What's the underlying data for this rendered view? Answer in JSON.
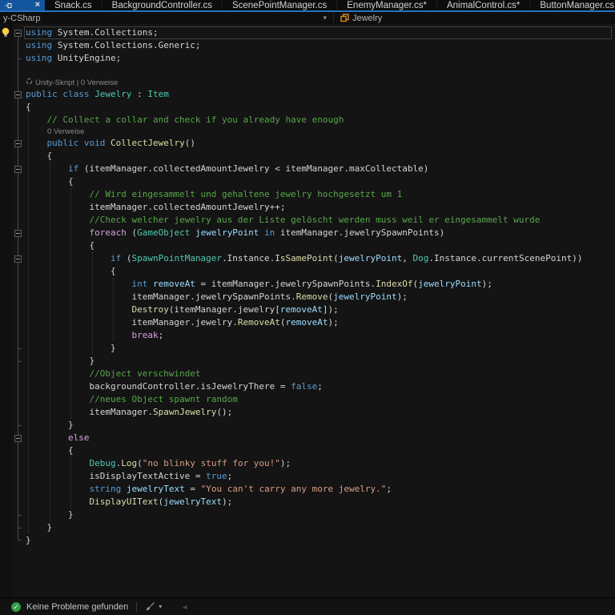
{
  "colors": {
    "accent_tab_blue": "#14569d",
    "accent_underline": "#2572c4",
    "keyword": "#569cd6",
    "control": "#d8a0df",
    "type": "#4ec9b0",
    "method": "#dcdcaa",
    "variable": "#9cdcfe",
    "string": "#d69d85",
    "comment": "#57a64a",
    "plain": "#d4d4d4",
    "status_green": "#2f9e44"
  },
  "tab_bar": {
    "active_tab": {
      "pinned": true,
      "close_label": "×"
    },
    "tabs": [
      "Snack.cs",
      "BackgroundController.cs",
      "ScenePointManager.cs",
      "EnemyManager.cs*",
      "AnimalControl.cs*",
      "ButtonManager.cs"
    ]
  },
  "nav_bar": {
    "project": "y-CSharp",
    "project_caret": "▾",
    "member": "Jewelry"
  },
  "status_bar": {
    "health": "Keine Probleme gefunden",
    "cleanup_caret": "▾",
    "scroll_left_arrow": "◄"
  },
  "code": {
    "lines": [
      {
        "t": "code",
        "fold": true,
        "current": true,
        "bulb": true,
        "tokens": [
          [
            "k",
            "using"
          ],
          [
            "p",
            " System.Collections;"
          ]
        ]
      },
      {
        "t": "code",
        "tokens": [
          [
            "k",
            "using"
          ],
          [
            "p",
            " System.Collections.Generic;"
          ]
        ]
      },
      {
        "t": "code",
        "tokens": [
          [
            "k",
            "using"
          ],
          [
            "p",
            " UnityEngine;"
          ]
        ]
      },
      {
        "t": "blank",
        "tokens": []
      },
      {
        "t": "lens",
        "indent": 3,
        "icon": true,
        "text": "Unity-Skript | 0 Verweise"
      },
      {
        "t": "code",
        "fold": true,
        "tokens": [
          [
            "k",
            "public"
          ],
          [
            "p",
            " "
          ],
          [
            "k",
            "class"
          ],
          [
            "p",
            " "
          ],
          [
            "t",
            "Jewelry"
          ],
          [
            "p",
            " : "
          ],
          [
            "t",
            "Item"
          ]
        ]
      },
      {
        "t": "code",
        "tokens": [
          [
            "p",
            "{"
          ]
        ]
      },
      {
        "t": "code",
        "tokens": [
          [
            "cm",
            "    // Collect a collar and check if you already have enough"
          ]
        ]
      },
      {
        "t": "lens",
        "indent": 30,
        "icon": false,
        "text": "0 Verweise"
      },
      {
        "t": "code",
        "fold": true,
        "tokens": [
          [
            "p",
            "    "
          ],
          [
            "k",
            "public"
          ],
          [
            "p",
            " "
          ],
          [
            "k",
            "void"
          ],
          [
            "p",
            " "
          ],
          [
            "m",
            "CollectJewelry"
          ],
          [
            "p",
            "()"
          ]
        ]
      },
      {
        "t": "code",
        "tokens": [
          [
            "p",
            "    {"
          ]
        ]
      },
      {
        "t": "code",
        "fold": true,
        "tokens": [
          [
            "p",
            "        "
          ],
          [
            "k",
            "if"
          ],
          [
            "p",
            " (itemManager.collectedAmountJewelry < itemManager.maxCollectable)"
          ]
        ]
      },
      {
        "t": "code",
        "tokens": [
          [
            "p",
            "        {"
          ]
        ]
      },
      {
        "t": "code",
        "tokens": [
          [
            "cm",
            "            // Wird eingesammelt und gehaltene jewelry hochgesetzt um 1"
          ]
        ]
      },
      {
        "t": "code",
        "tokens": [
          [
            "p",
            "            itemManager.collectedAmountJewelry++;"
          ]
        ]
      },
      {
        "t": "code",
        "tokens": [
          [
            "cm",
            "            //Check welcher jewelry aus der Liste gelöscht werden muss weil er eingesammelt wurde"
          ]
        ]
      },
      {
        "t": "code",
        "fold": true,
        "tokens": [
          [
            "p",
            "            "
          ],
          [
            "c",
            "foreach"
          ],
          [
            "p",
            " ("
          ],
          [
            "t",
            "GameObject"
          ],
          [
            "p",
            " "
          ],
          [
            "v",
            "jewelryPoint"
          ],
          [
            "p",
            " "
          ],
          [
            "k",
            "in"
          ],
          [
            "p",
            " itemManager.jewelrySpawnPoints)"
          ]
        ]
      },
      {
        "t": "code",
        "tokens": [
          [
            "p",
            "            {"
          ]
        ]
      },
      {
        "t": "code",
        "fold": true,
        "tokens": [
          [
            "p",
            "                "
          ],
          [
            "k",
            "if"
          ],
          [
            "p",
            " ("
          ],
          [
            "t",
            "SpawnPointManager"
          ],
          [
            "p",
            ".Instance."
          ],
          [
            "m",
            "IsSamePoint"
          ],
          [
            "p",
            "("
          ],
          [
            "v",
            "jewelryPoint"
          ],
          [
            "p",
            ", "
          ],
          [
            "t",
            "Dog"
          ],
          [
            "p",
            ".Instance.currentScenePoint))"
          ]
        ]
      },
      {
        "t": "code",
        "tokens": [
          [
            "p",
            "                {"
          ]
        ]
      },
      {
        "t": "code",
        "tokens": [
          [
            "p",
            "                    "
          ],
          [
            "k",
            "int"
          ],
          [
            "p",
            " "
          ],
          [
            "v",
            "removeAt"
          ],
          [
            "p",
            " = itemManager.jewelrySpawnPoints."
          ],
          [
            "m",
            "IndexOf"
          ],
          [
            "p",
            "("
          ],
          [
            "v",
            "jewelryPoint"
          ],
          [
            "p",
            ");"
          ]
        ]
      },
      {
        "t": "code",
        "tokens": [
          [
            "p",
            "                    itemManager.jewelrySpawnPoints."
          ],
          [
            "m",
            "Remove"
          ],
          [
            "p",
            "("
          ],
          [
            "v",
            "jewelryPoint"
          ],
          [
            "p",
            ");"
          ]
        ]
      },
      {
        "t": "code",
        "tokens": [
          [
            "p",
            "                    "
          ],
          [
            "m",
            "Destroy"
          ],
          [
            "p",
            "(itemManager.jewelry["
          ],
          [
            "v",
            "removeAt"
          ],
          [
            "p",
            "]);"
          ]
        ]
      },
      {
        "t": "code",
        "tokens": [
          [
            "p",
            "                    itemManager.jewelry."
          ],
          [
            "m",
            "RemoveAt"
          ],
          [
            "p",
            "("
          ],
          [
            "v",
            "removeAt"
          ],
          [
            "p",
            ");"
          ]
        ]
      },
      {
        "t": "code",
        "tokens": [
          [
            "p",
            "                    "
          ],
          [
            "c",
            "break"
          ],
          [
            "p",
            ";"
          ]
        ]
      },
      {
        "t": "code",
        "tokens": [
          [
            "p",
            "                }"
          ]
        ]
      },
      {
        "t": "code",
        "tokens": [
          [
            "p",
            "            }"
          ]
        ]
      },
      {
        "t": "code",
        "tokens": [
          [
            "cm",
            "            //Object verschwindet"
          ]
        ]
      },
      {
        "t": "code",
        "tokens": [
          [
            "p",
            "            backgroundController.isJewelryThere = "
          ],
          [
            "k",
            "false"
          ],
          [
            "p",
            ";"
          ]
        ]
      },
      {
        "t": "code",
        "tokens": [
          [
            "cm",
            "            //neues Object spawnt random"
          ]
        ]
      },
      {
        "t": "code",
        "tokens": [
          [
            "p",
            "            itemManager."
          ],
          [
            "m",
            "SpawnJewelry"
          ],
          [
            "p",
            "();"
          ]
        ]
      },
      {
        "t": "code",
        "tokens": [
          [
            "p",
            "        }"
          ]
        ]
      },
      {
        "t": "code",
        "fold": true,
        "tokens": [
          [
            "p",
            "        "
          ],
          [
            "c",
            "else"
          ]
        ]
      },
      {
        "t": "code",
        "tokens": [
          [
            "p",
            "        {"
          ]
        ]
      },
      {
        "t": "code",
        "tokens": [
          [
            "p",
            "            "
          ],
          [
            "t",
            "Debug"
          ],
          [
            "p",
            "."
          ],
          [
            "m",
            "Log"
          ],
          [
            "p",
            "("
          ],
          [
            "s",
            "\"no blinky stuff for you!\""
          ],
          [
            "p",
            ");"
          ]
        ]
      },
      {
        "t": "code",
        "tokens": [
          [
            "p",
            "            isDisplayTextActive = "
          ],
          [
            "k",
            "true"
          ],
          [
            "p",
            ";"
          ]
        ]
      },
      {
        "t": "code",
        "tokens": [
          [
            "p",
            "            "
          ],
          [
            "k",
            "string"
          ],
          [
            "p",
            " "
          ],
          [
            "v",
            "jewelryText"
          ],
          [
            "p",
            " = "
          ],
          [
            "s",
            "\"You can't carry any more jewelry.\""
          ],
          [
            "p",
            ";"
          ]
        ]
      },
      {
        "t": "code",
        "tokens": [
          [
            "p",
            "            "
          ],
          [
            "m",
            "DisplayUIText"
          ],
          [
            "p",
            "("
          ],
          [
            "v",
            "jewelryText"
          ],
          [
            "p",
            ");"
          ]
        ]
      },
      {
        "t": "code",
        "tokens": [
          [
            "p",
            "        }"
          ]
        ]
      },
      {
        "t": "code",
        "tokens": [
          [
            "p",
            "    }"
          ]
        ]
      },
      {
        "t": "code",
        "tokens": [
          [
            "p",
            "}"
          ]
        ]
      }
    ]
  }
}
